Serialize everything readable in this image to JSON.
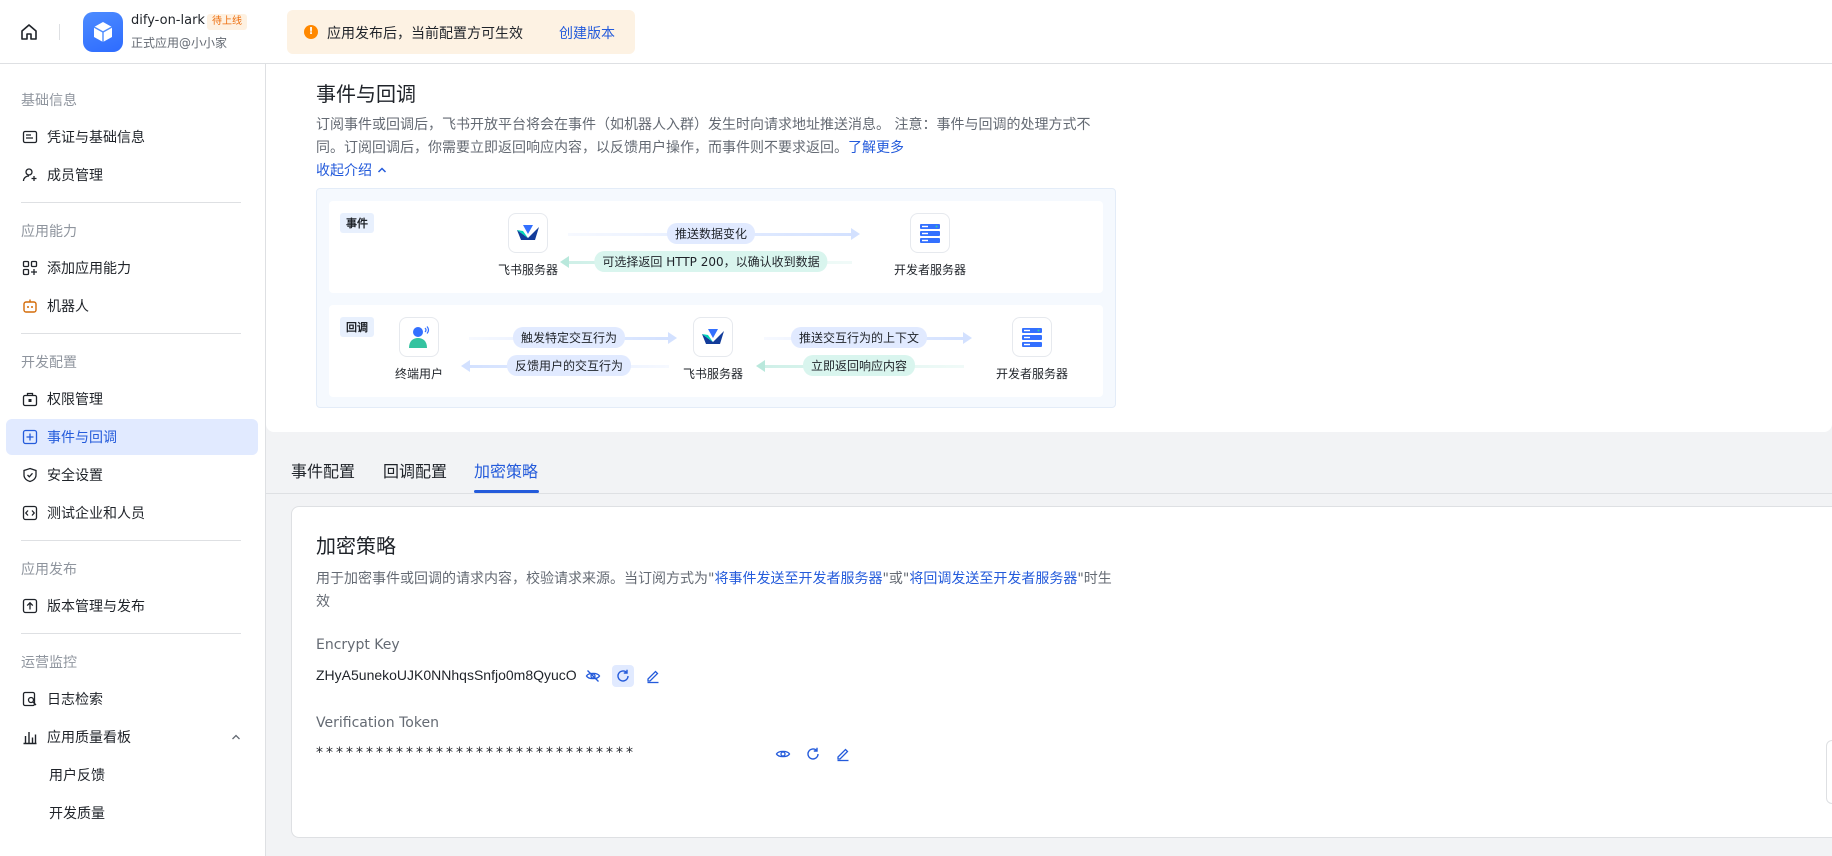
{
  "header": {
    "app_name": "dify-on-lark",
    "status_badge": "待上线",
    "app_subtitle": "正式应用@小小家",
    "notice_text": "应用发布后，当前配置方可生效",
    "notice_link": "创建版本"
  },
  "sidebar": {
    "sections": {
      "basic": "基础信息",
      "capability": "应用能力",
      "dev": "开发配置",
      "release": "应用发布",
      "monitor": "运营监控"
    },
    "items": {
      "credentials": "凭证与基础信息",
      "members": "成员管理",
      "add_capability": "添加应用能力",
      "bot": "机器人",
      "permissions": "权限管理",
      "events": "事件与回调",
      "security": "安全设置",
      "test_enterprise": "测试企业和人员",
      "versions": "版本管理与发布",
      "log_search": "日志检索",
      "quality_board": "应用质量看板",
      "user_feedback": "用户反馈",
      "dev_quality": "开发质量"
    }
  },
  "intro": {
    "title": "事件与回调",
    "desc_line1": "订阅事件或回调后，飞书开放平台将会在事件（如机器人入群）发生时向请求地址推送消息。 注意：事件与回调的处理方式不",
    "desc_line2": "同。订阅回调后，你需要立即返回响应内容，以反馈用户操作，而事件则不要求返回。",
    "learn_more": "了解更多",
    "collapse": "收起介绍",
    "diagram": {
      "event_tag": "事件",
      "callback_tag": "回调",
      "feishu_server": "飞书服务器",
      "dev_server": "开发者服务器",
      "end_user": "终端用户",
      "push_data_change": "推送数据变化",
      "optional_return": "可选择返回 HTTP 200，以确认收到数据",
      "trigger_interaction": "触发特定交互行为",
      "feedback_interaction": "反馈用户的交互行为",
      "push_context": "推送交互行为的上下文",
      "immediate_return": "立即返回响应内容"
    }
  },
  "tabs": [
    "事件配置",
    "回调配置",
    "加密策略"
  ],
  "encryption": {
    "title": "加密策略",
    "desc_prefix": "用于加密事件或回调的请求内容，校验请求来源。当订阅方式为\"",
    "link1": "将事件发送至开发者服务器",
    "desc_mid": "\"或\"",
    "link2": "将回调发送至开发者服务器",
    "desc_suffix": "\"时生",
    "desc_line2": "效",
    "encrypt_key_label": "Encrypt Key",
    "encrypt_key_value": "ZHyA5unekoUJK0NNhqsSnfjo0m8QyucO",
    "verification_token_label": "Verification Token",
    "verification_token_value": "********************************"
  },
  "colors": {
    "accent": "#245bdb",
    "active_bg": "#e1eaff",
    "warning": "#ff8800",
    "badge_text": "#ed6d0c"
  },
  "icons": {
    "home": "home-icon",
    "app": "cube-icon",
    "hide": "eye-off-icon",
    "show": "eye-icon",
    "refresh": "refresh-icon",
    "edit": "edit-icon"
  }
}
